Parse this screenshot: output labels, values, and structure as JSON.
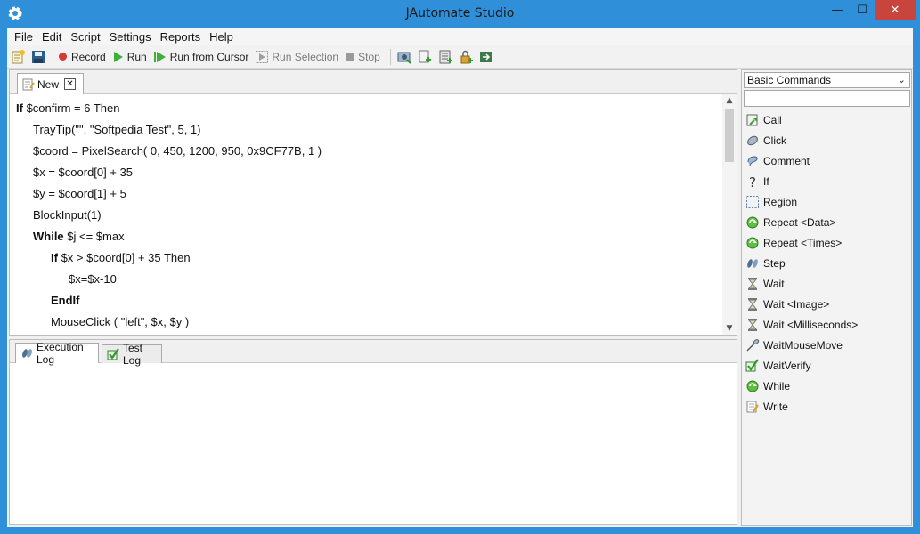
{
  "window": {
    "title": "JAutomate Studio",
    "min_glyph": "—",
    "max_glyph": "☐",
    "close_glyph": "✕"
  },
  "menu": [
    "File",
    "Edit",
    "Script",
    "Settings",
    "Reports",
    "Help"
  ],
  "toolbar": {
    "record_label": "Record",
    "run_label": "Run",
    "run_from_cursor_label": "Run from Cursor",
    "run_selection_label": "Run Selection",
    "stop_label": "Stop"
  },
  "editor": {
    "tab_label": "New",
    "lines": [
      {
        "indent": 0,
        "parts": [
          {
            "t": "If",
            "kw": true
          },
          {
            "t": " $confirm = 6 Then"
          }
        ]
      },
      {
        "indent": 1,
        "parts": [
          {
            "t": "TrayTip(\"\", \"Softpedia Test\", 5, 1)"
          }
        ]
      },
      {
        "indent": 1,
        "parts": [
          {
            "t": "$coord = PixelSearch( 0, 450, 1200, 950, 0x9CF77B, 1 )"
          }
        ]
      },
      {
        "indent": 1,
        "parts": [
          {
            "t": "$x = $coord[0] + 35"
          }
        ]
      },
      {
        "indent": 1,
        "parts": [
          {
            "t": "$y = $coord[1] + 5"
          }
        ]
      },
      {
        "indent": 1,
        "parts": [
          {
            "t": "BlockInput(1)"
          }
        ]
      },
      {
        "indent": 1,
        "parts": [
          {
            "t": "While",
            "kw": true
          },
          {
            "t": " $j <= $max"
          }
        ]
      },
      {
        "indent": 2,
        "parts": [
          {
            "t": "If",
            "kw": true
          },
          {
            "t": " $x > $coord[0] + 35 Then"
          }
        ]
      },
      {
        "indent": 3,
        "parts": [
          {
            "t": "$x=$x-10"
          }
        ]
      },
      {
        "indent": 2,
        "parts": [
          {
            "t": "EndIf",
            "kw": true
          }
        ]
      },
      {
        "indent": 2,
        "parts": [
          {
            "t": "MouseClick ( \"left\", $x, $y )"
          }
        ]
      }
    ]
  },
  "log_tabs": [
    "Execution Log",
    "Test Log"
  ],
  "commands": {
    "category": "Basic Commands",
    "items": [
      {
        "label": "Call",
        "icon": "call-icon"
      },
      {
        "label": "Click",
        "icon": "mouse-icon"
      },
      {
        "label": "Comment",
        "icon": "comment-icon"
      },
      {
        "label": "If",
        "icon": "question-icon"
      },
      {
        "label": "Region",
        "icon": "region-icon"
      },
      {
        "label": "Repeat <Data>",
        "icon": "repeat-icon"
      },
      {
        "label": "Repeat <Times>",
        "icon": "repeat-icon"
      },
      {
        "label": "Step",
        "icon": "footsteps-icon"
      },
      {
        "label": "Wait",
        "icon": "hourglass-icon"
      },
      {
        "label": "Wait <Image>",
        "icon": "hourglass-icon"
      },
      {
        "label": "Wait <Milliseconds>",
        "icon": "hourglass-icon"
      },
      {
        "label": "WaitMouseMove",
        "icon": "mouse-move-icon"
      },
      {
        "label": "WaitVerify",
        "icon": "check-icon"
      },
      {
        "label": "While",
        "icon": "repeat-icon"
      },
      {
        "label": "Write",
        "icon": "pencil-icon"
      }
    ]
  },
  "colors": {
    "titlebar": "#2f8fd8",
    "record_dot": "#d23b2f",
    "run_green": "#3fae3a"
  }
}
